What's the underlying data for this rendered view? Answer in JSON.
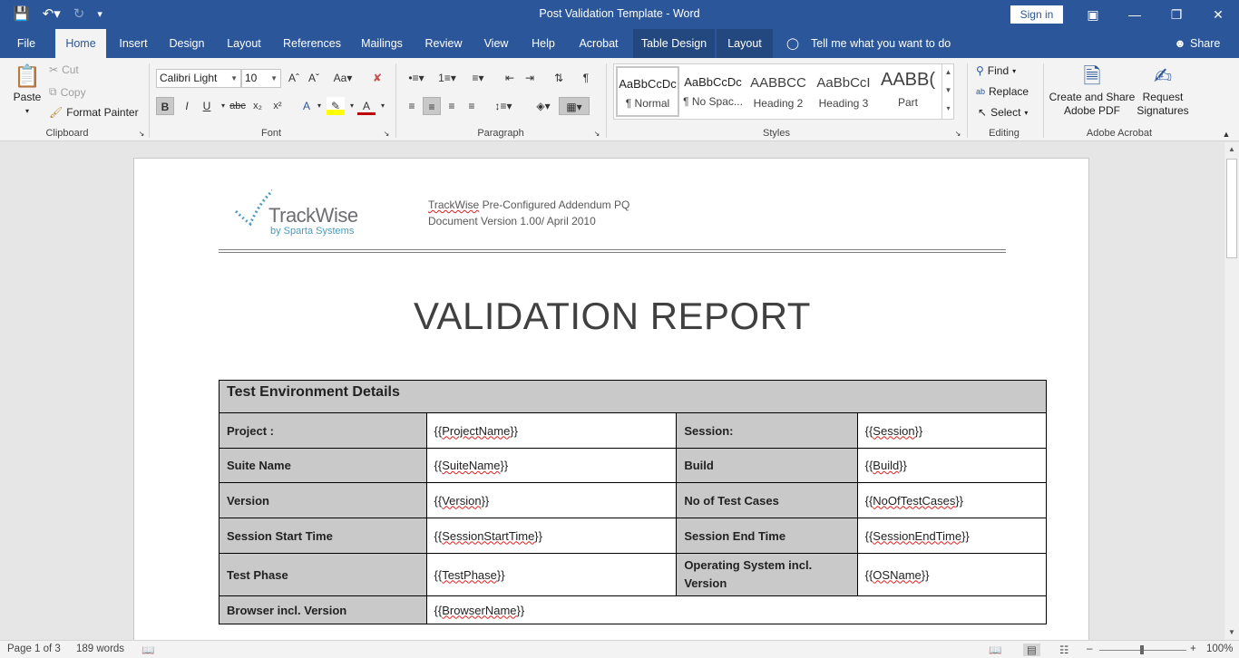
{
  "window": {
    "title": "Post Validation Template  -  Word",
    "sign_in": "Sign in",
    "qat": {
      "save_icon": "save-icon",
      "undo_icon": "undo-icon",
      "redo_icon": "redo-icon",
      "customize_icon": "customize-icon"
    }
  },
  "tabs": {
    "file": "File",
    "home": "Home",
    "insert": "Insert",
    "design": "Design",
    "layout": "Layout",
    "references": "References",
    "mailings": "Mailings",
    "review": "Review",
    "view": "View",
    "help": "Help",
    "acrobat": "Acrobat",
    "table_design": "Table Design",
    "table_layout": "Layout",
    "tell_me": "Tell me what you want to do",
    "share": "Share"
  },
  "ribbon": {
    "clipboard": {
      "label": "Clipboard",
      "paste": "Paste",
      "cut": "Cut",
      "copy": "Copy",
      "format_painter": "Format Painter"
    },
    "font": {
      "label": "Font",
      "font_name": "Calibri Light",
      "font_size": "10"
    },
    "paragraph": {
      "label": "Paragraph"
    },
    "styles": {
      "label": "Styles",
      "items": [
        {
          "preview": "AaBbCcDc",
          "name": "¶ Normal"
        },
        {
          "preview": "AaBbCcDc",
          "name": "¶ No Spac..."
        },
        {
          "preview": "AABBCC",
          "name": "Heading 2"
        },
        {
          "preview": "AaBbCcI",
          "name": "Heading 3"
        },
        {
          "preview": "AABB(",
          "name": "Part"
        }
      ]
    },
    "editing": {
      "label": "Editing",
      "find": "Find",
      "replace": "Replace",
      "select": "Select"
    },
    "acrobat": {
      "label": "Adobe Acrobat",
      "create_share_1": "Create and Share",
      "create_share_2": "Adobe PDF",
      "request_1": "Request",
      "request_2": "Signatures"
    }
  },
  "document": {
    "logo_text": "TrackWise",
    "logo_sub": "by Sparta Systems",
    "header_line1_brand": "TrackWise",
    "header_line1_rest": " Pre-Configured Addendum PQ",
    "header_line2": "Document Version 1.00/ April 2010",
    "title": "VALIDATION REPORT",
    "table": {
      "heading": "Test Environment Details",
      "rows": [
        {
          "l1": "Project :",
          "v1": "{{ProjectName}}",
          "l2": "Session:",
          "v2": "{{Session}}"
        },
        {
          "l1": "Suite Name",
          "v1": "{{SuiteName}}",
          "l2": "Build",
          "v2": "{{Build}}"
        },
        {
          "l1": "Version",
          "v1": "{{Version}}",
          "l2": "No of Test Cases",
          "v2": "{{NoOfTestCases}}"
        },
        {
          "l1": "Session Start Time",
          "v1": "{{SessionStartTime}}",
          "l2": "Session End Time",
          "v2": "{{SessionEndTime}}"
        },
        {
          "l1": "Test Phase",
          "v1": "{{TestPhase}}",
          "l2": "Operating System incl. Version",
          "v2": "{{OSName}}"
        }
      ],
      "last_row": {
        "l1": "Browser incl. Version",
        "v1": "{{BrowserName}}"
      }
    }
  },
  "status": {
    "page": "Page 1 of 3",
    "words": "189 words",
    "zoom": "100%"
  }
}
